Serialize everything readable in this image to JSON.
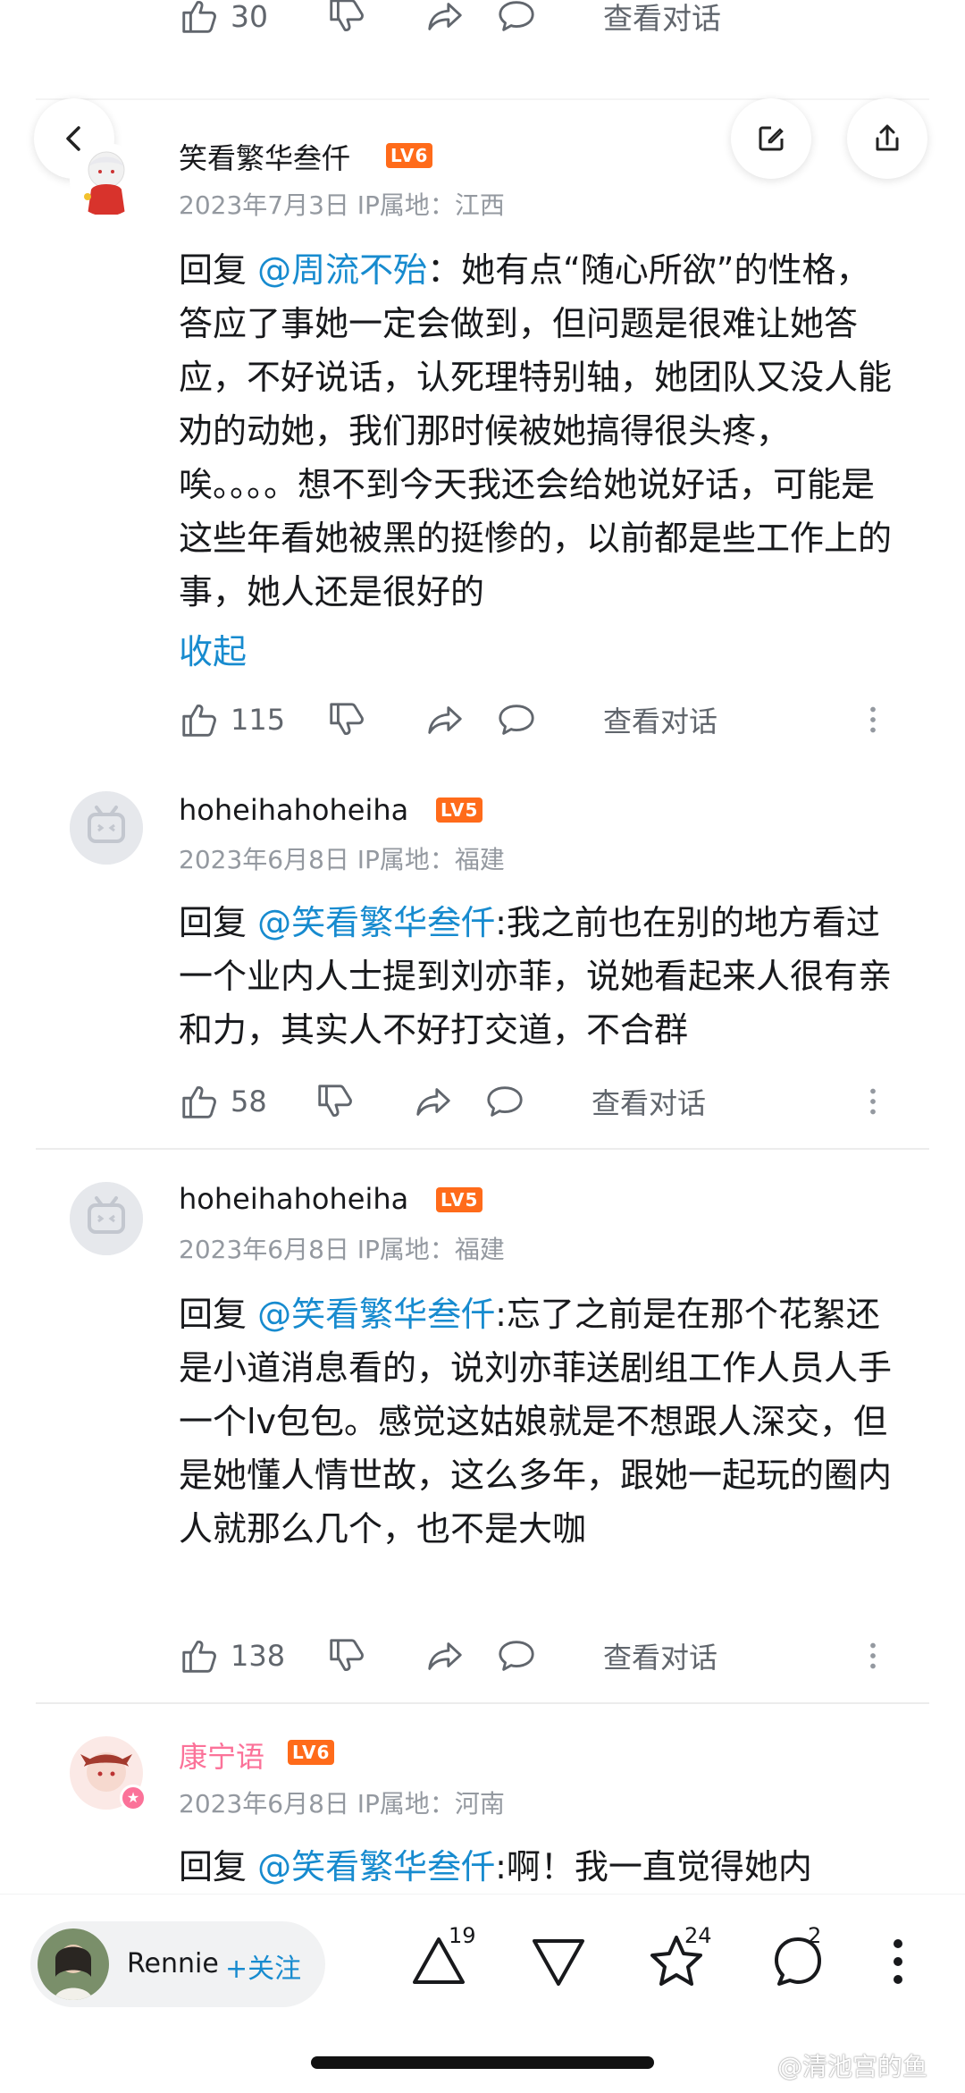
{
  "top_row": {
    "likes": "30",
    "view_dialog": "查看对话"
  },
  "comments": [
    {
      "username": "笑看繁华叁仟",
      "level": "LV6",
      "meta": "2023年7月3日  IP属地：江西",
      "reply_label": "回复 ",
      "mention": "@周流不殆",
      "text": "：她有点“随心所欲”的性格，答应了事她一定会做到，但问题是很难让她答应，不好说话，认死理特别轴，她团队又没人能劝的动她，我们那时候被她搞得很头疼，唉。。。。想不到今天我还会给她说好话，可能是这些年看她被黑的挺惨的，以前都是些工作上的事，她人还是很好的",
      "collapse": "收起",
      "likes": "115",
      "view_dialog": "查看对话"
    },
    {
      "username": "hoheihahoheiha",
      "level": "LV5",
      "meta": "2023年6月8日  IP属地：福建",
      "reply_label": "回复 ",
      "mention": "@笑看繁华叁仟",
      "text": ":我之前也在别的地方看过一个业内人士提到刘亦菲，说她看起来人很有亲和力，其实人不好打交道，不合群",
      "likes": "58",
      "view_dialog": "查看对话"
    },
    {
      "username": "hoheihahoheiha",
      "level": "LV5",
      "meta": "2023年6月8日  IP属地：福建",
      "reply_label": "回复 ",
      "mention": "@笑看繁华叁仟",
      "text": ":忘了之前是在那个花絮还是小道消息看的，说刘亦菲送剧组工作人员人手一个lv包包。感觉这姑娘就是不想跟人深交，但是她懂人情世故，这么多年，跟她一起玩的圈内人就那么几个，也不是大咖",
      "likes": "138",
      "view_dialog": "查看对话"
    },
    {
      "username": "康宁语",
      "level": "LV6",
      "meta": "2023年6月8日  IP属地：河南",
      "reply_label": "回复 ",
      "mention": "@笑看繁华叁仟",
      "text": ":啊！我一直觉得她内"
    }
  ],
  "bottom_bar": {
    "user_name": "Rennie",
    "follow_label": "+关注",
    "like_count": "19",
    "coin_count": "24",
    "comment_count": "2"
  },
  "watermark": "@清池宫的鱼",
  "colors": {
    "link": "#178bcf",
    "level_badge": "#ff6b1a",
    "pink_name": "#fb7299",
    "meta": "#9499a0"
  }
}
